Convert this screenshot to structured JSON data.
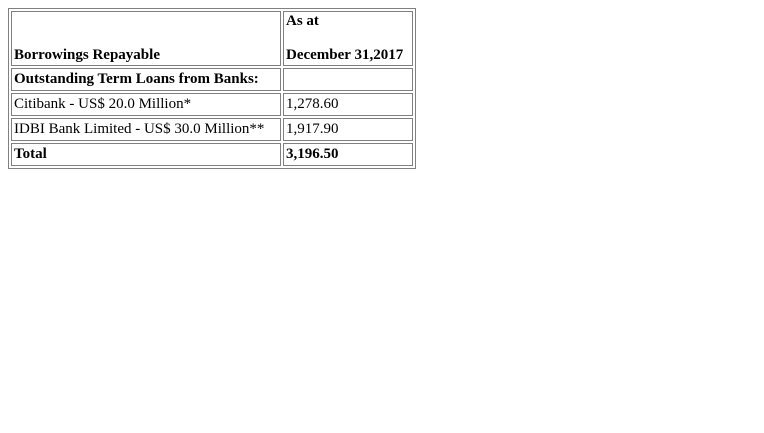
{
  "table": {
    "header": {
      "col1": "Borrowings Repayable",
      "col2_line1": "As at",
      "col2_line2": "December 31,2017"
    },
    "section_title": "Outstanding Term Loans from Banks:",
    "rows": [
      {
        "label": "Citibank - US$ 20.0 Million*",
        "value": "1,278.60"
      },
      {
        "label": "IDBI Bank Limited - US$ 30.0 Million**",
        "value": "1,917.90"
      }
    ],
    "total": {
      "label": "Total",
      "value": "3,196.50"
    }
  }
}
